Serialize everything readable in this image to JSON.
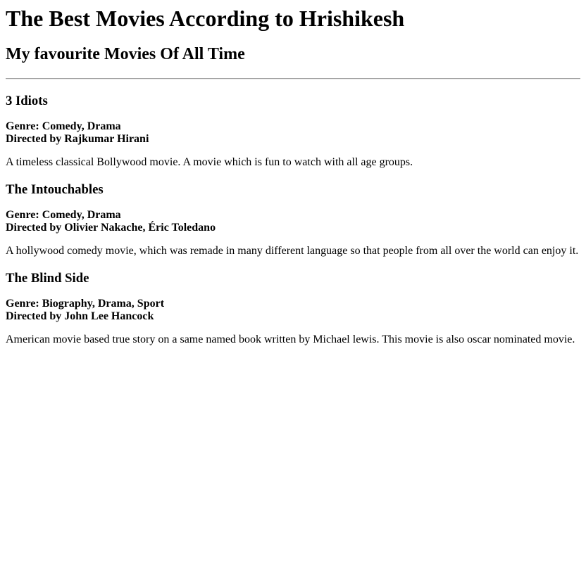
{
  "page": {
    "title": "The Best Movies According to Hrishikesh",
    "subtitle": "My favourite Movies Of All Time"
  },
  "movies": [
    {
      "title": "3 Idiots",
      "genre": "Genre: Comedy, Drama",
      "director": "Directed by Rajkumar Hirani",
      "description": "A timeless classical Bollywood movie. A movie which is fun to watch with all age groups."
    },
    {
      "title": "The Intouchables",
      "genre": "Genre: Comedy, Drama",
      "director": "Directed by Olivier Nakache, Éric Toledano",
      "description": "A hollywood comedy movie, which was remade in many different language so that people from all over the world can enjoy it."
    },
    {
      "title": "The Blind Side",
      "genre": "Genre: Biography, Drama, Sport",
      "director": "Directed by John Lee Hancock",
      "description": "American movie based true story on a same named book written by Michael lewis. This movie is also oscar nominated movie."
    }
  ]
}
